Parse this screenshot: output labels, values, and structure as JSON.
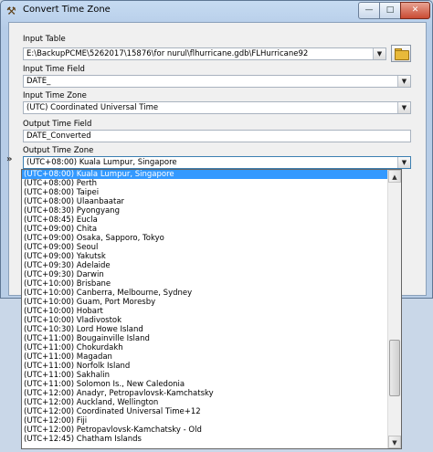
{
  "window": {
    "title": "Convert Time Zone",
    "buttons": {
      "minimize": "—",
      "maximize": "□",
      "close": "✕"
    }
  },
  "form": {
    "input_table_label": "Input Table",
    "input_table_value": "E:\\BackupPCME\\5262017\\15876\\for nurul\\flhurricane.gdb\\FLHurricane92",
    "input_time_field_label": "Input Time Field",
    "input_time_field_value": "DATE_",
    "input_time_zone_label": "Input Time Zone",
    "input_time_zone_value": "(UTC) Coordinated Universal Time",
    "output_time_field_label": "Output Time Field",
    "output_time_field_value": "DATE_Converted",
    "output_time_zone_label": "Output Time Zone",
    "output_time_zone_value": "(UTC+08:00) Kuala Lumpur, Singapore"
  },
  "icons": {
    "app": "hammer-icon",
    "browse": "folder-open-icon",
    "combo_arrow": "chevron-down-icon",
    "collapse": "double-chevron-icon"
  },
  "dropdown": {
    "items": [
      "(UTC+08:00) Kuala Lumpur, Singapore",
      "(UTC+08:00) Perth",
      "(UTC+08:00) Taipei",
      "(UTC+08:00) Ulaanbaatar",
      "(UTC+08:30) Pyongyang",
      "(UTC+08:45) Eucla",
      "(UTC+09:00) Chita",
      "(UTC+09:00) Osaka, Sapporo, Tokyo",
      "(UTC+09:00) Seoul",
      "(UTC+09:00) Yakutsk",
      "(UTC+09:30) Adelaide",
      "(UTC+09:30) Darwin",
      "(UTC+10:00) Brisbane",
      "(UTC+10:00) Canberra, Melbourne, Sydney",
      "(UTC+10:00) Guam, Port Moresby",
      "(UTC+10:00) Hobart",
      "(UTC+10:00) Vladivostok",
      "(UTC+10:30) Lord Howe Island",
      "(UTC+11:00) Bougainville Island",
      "(UTC+11:00) Chokurdakh",
      "(UTC+11:00) Magadan",
      "(UTC+11:00) Norfolk Island",
      "(UTC+11:00) Sakhalin",
      "(UTC+11:00) Solomon Is., New Caledonia",
      "(UTC+12:00) Anadyr, Petropavlovsk-Kamchatsky",
      "(UTC+12:00) Auckland, Wellington",
      "(UTC+12:00) Coordinated Universal Time+12",
      "(UTC+12:00) Fiji",
      "(UTC+12:00) Petropavlovsk-Kamchatsky - Old",
      "(UTC+12:45) Chatham Islands"
    ],
    "selected_index": 0,
    "scroll_position": 0.8,
    "selection_color": "#3399ff"
  }
}
